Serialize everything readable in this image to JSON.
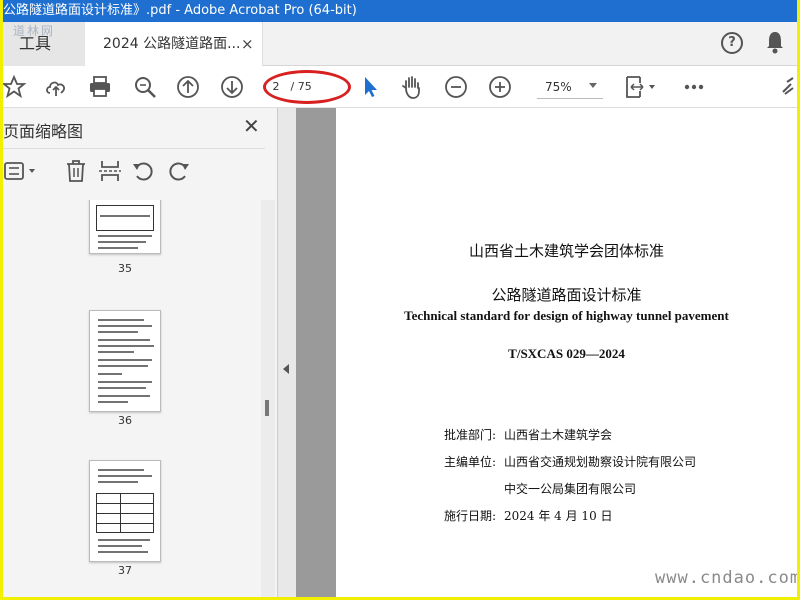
{
  "window": {
    "title": "公路隧道路面设计标准》.pdf - Adobe Acrobat Pro (64-bit)"
  },
  "tabs": {
    "tools_label": "工具",
    "doc_label": "2024 公路隧道路面...",
    "close_glyph": "×",
    "logo_text": "道林网"
  },
  "toolbar": {
    "page_current": "2",
    "page_total": "/ 75",
    "zoom": "75%"
  },
  "sidebar": {
    "title": "页面缩略图",
    "close_glyph": "✕",
    "thumbnails": [
      {
        "label": "35"
      },
      {
        "label": "36"
      },
      {
        "label": "37"
      }
    ]
  },
  "document": {
    "org_standard": "山西省土木建筑学会团体标准",
    "title_cn": "公路隧道路面设计标准",
    "title_en": "Technical standard for design of highway tunnel pavement",
    "code": "T/SXCAS 029—2024",
    "info": [
      {
        "key": "批准部门:",
        "value": "山西省土木建筑学会"
      },
      {
        "key": "主编单位:",
        "value": "山西省交通规划勘察设计院有限公司"
      },
      {
        "key": "",
        "value": "中交一公局集团有限公司"
      },
      {
        "key": "施行日期:",
        "value": "2024 年 4 月 10 日"
      }
    ]
  },
  "watermark": "www.cndao.com",
  "colors": {
    "title_bar": "#1e6fd0",
    "frame_border": "#f0f000",
    "highlight_circle": "#d82020",
    "select_cursor": "#1e6fd0"
  }
}
